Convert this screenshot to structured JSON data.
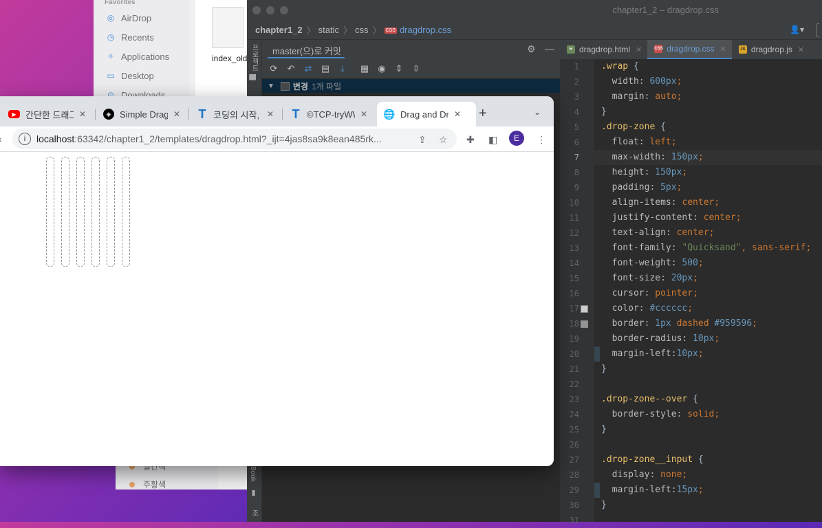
{
  "finder": {
    "section": "Favorites",
    "items": [
      {
        "label": "AirDrop",
        "icon": "airdrop-icon"
      },
      {
        "label": "Recents",
        "icon": "clock-icon"
      },
      {
        "label": "Applications",
        "icon": "applications-icon"
      },
      {
        "label": "Desktop",
        "icon": "desktop-icon"
      },
      {
        "label": "Downloads",
        "icon": "downloads-icon"
      }
    ],
    "file_label": "index_old",
    "tags": [
      {
        "label": "빨간색"
      },
      {
        "label": "주황색",
        "color": "#e8a46b"
      }
    ]
  },
  "ide": {
    "title": "chapter1_2 – dragdrop.css",
    "breadcrumbs": [
      "chapter1_2",
      "static",
      "css",
      "dragdrop.css"
    ],
    "side_labels": [
      "프로젝트",
      "Book",
      "구조"
    ],
    "commit": {
      "title": "master(으)로 커밋",
      "changes_label": "변경",
      "changes_count": "1개 파일"
    },
    "tabs": [
      {
        "label": "dragdrop.html",
        "type": "html",
        "badge": "H"
      },
      {
        "label": "dragdrop.css",
        "type": "css",
        "badge": "CSS",
        "active": true
      },
      {
        "label": "dragdrop.js",
        "type": "js",
        "badge": "JS"
      }
    ],
    "active_line": 7,
    "code": [
      ".wrap {",
      "  width: 600px;",
      "  margin: auto;",
      "}",
      ".drop-zone {",
      "  float: left;",
      "  max-width: 150px;",
      "  height: 150px;",
      "  padding: 5px;",
      "  align-items: center;",
      "  justify-content: center;",
      "  text-align: center;",
      "  font-family: \"Quicksand\", sans-serif;",
      "  font-weight: 500;",
      "  font-size: 20px;",
      "  cursor: pointer;",
      "  color: #cccccc;",
      "  border: 1px dashed #959596;",
      "  border-radius: 10px;",
      "  margin-left:10px;",
      "}",
      "",
      ".drop-zone--over {",
      "  border-style: solid;",
      "}",
      "",
      ".drop-zone__input {",
      "  display: none;",
      "  margin-left:15px;",
      "}",
      ""
    ]
  },
  "browser": {
    "tabs": [
      {
        "title": "간단한 드래그 앤",
        "favicon": "youtube-icon",
        "badge": "▶"
      },
      {
        "title": "Simple Drag and",
        "favicon": "codepen-icon",
        "badge": "◈"
      },
      {
        "title": "코딩의 시작, TCP",
        "favicon": "tcp-school-icon",
        "badge": "T"
      },
      {
        "title": "©TCP-tryWWW",
        "favicon": "tcp-school-icon",
        "badge": "T"
      },
      {
        "title": "Drag and Drop",
        "favicon": "globe-icon",
        "badge": "🌐",
        "active": true
      }
    ],
    "url_host": "localhost",
    "url_path": ":63342/chapter1_2/templates/dragdrop.html?_ijt=4jas8sa9k8ean485rk...",
    "profile_initial": "E",
    "drop_zone_count": 6,
    "drop_zone_border_color": "#959596"
  }
}
